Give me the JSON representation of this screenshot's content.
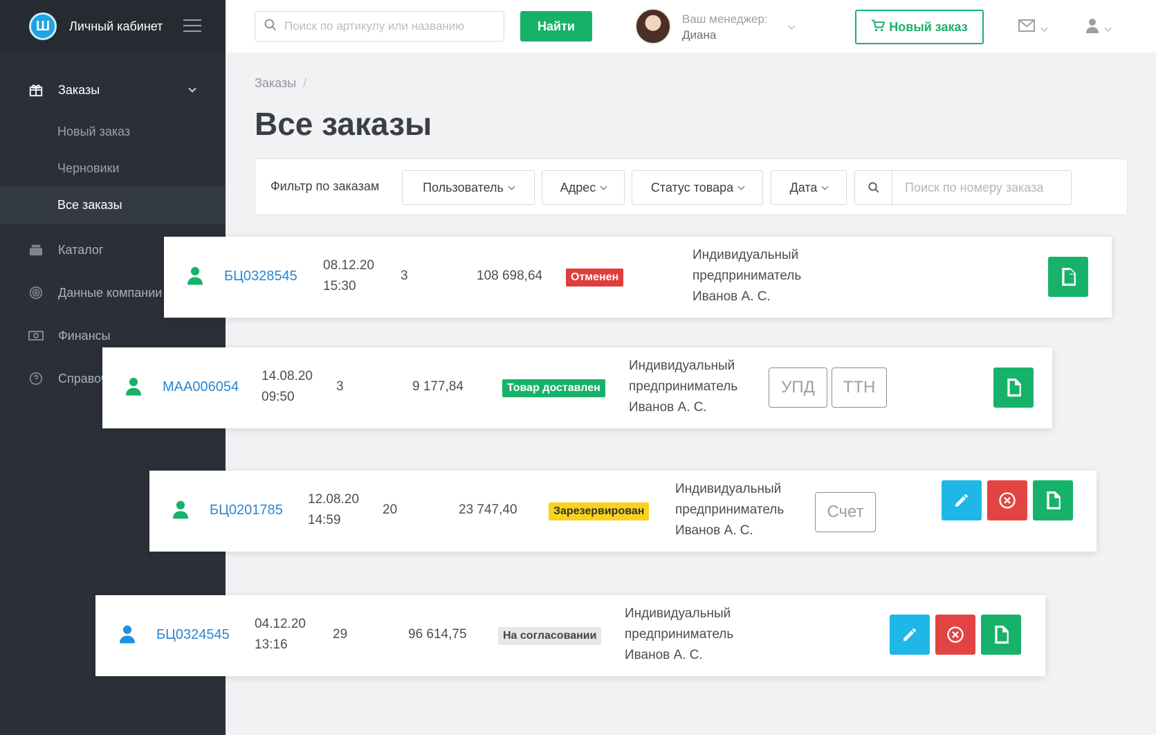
{
  "sidebar": {
    "title": "Личный кабинет",
    "menu": [
      {
        "label": "Заказы",
        "icon": "gift-icon"
      },
      {
        "label": "Каталог",
        "icon": "catalog-icon"
      },
      {
        "label": "Данные компании",
        "icon": "fingerprint-icon"
      },
      {
        "label": "Финансы",
        "icon": "money-icon"
      },
      {
        "label": "Справочная информация",
        "icon": "help-icon"
      }
    ],
    "submenu": [
      "Новый заказ",
      "Черновики",
      "Все заказы"
    ]
  },
  "topbar": {
    "search_placeholder": "Поиск по артикулу или названию",
    "find_label": "Найти",
    "manager_label": "Ваш менеджер:",
    "manager_name": "Диана",
    "new_order_label": "Новый заказ"
  },
  "breadcrumb": "Заказы",
  "page_title": "Все заказы",
  "filters": {
    "label": "Фильтр по заказам",
    "user": "Пользователь",
    "address": "Адрес",
    "status": "Статус товара",
    "date": "Дата",
    "search_placeholder": "Поиск по номеру заказа"
  },
  "orders": [
    {
      "number": "БЦ0328545",
      "date": "08.12.20",
      "time": "15:30",
      "qty": "3",
      "sum": "108 698,64",
      "status": "Отменен",
      "status_color": "#e03d3d",
      "customer": [
        "Индивидуальный",
        "предприниматель",
        "Иванов А. С."
      ]
    },
    {
      "number": "МАА006054",
      "date": "14.08.20",
      "time": "09:50",
      "qty": "3",
      "sum": "9 177,84",
      "status": "Товар доставлен",
      "status_color": "#17b26a",
      "customer": [
        "Индивидуальный",
        "предприниматель",
        "Иванов А. С."
      ],
      "docs": [
        "УПД",
        "ТТН"
      ]
    },
    {
      "number": "БЦ0201785",
      "date": "12.08.20",
      "time": "14:59",
      "qty": "20",
      "sum": "23 747,40",
      "status": "Зарезервирован",
      "status_color": "#f8d21c",
      "customer": [
        "Индивидуальный",
        "предприниматель",
        "Иванов А. С."
      ],
      "docs": [
        "Счет"
      ]
    },
    {
      "number": "БЦ0324545",
      "date": "04.12.20",
      "time": "13:16",
      "qty": "29",
      "sum": "96 614,75",
      "status": "На согласовании",
      "status_color": "#e6e7e9",
      "customer": [
        "Индивидуальный",
        "предприниматель",
        "Иванов А. С."
      ]
    }
  ],
  "colors": {
    "accent": "#17b26a",
    "link": "#2a86d1",
    "sidebar": "#2b3038"
  }
}
